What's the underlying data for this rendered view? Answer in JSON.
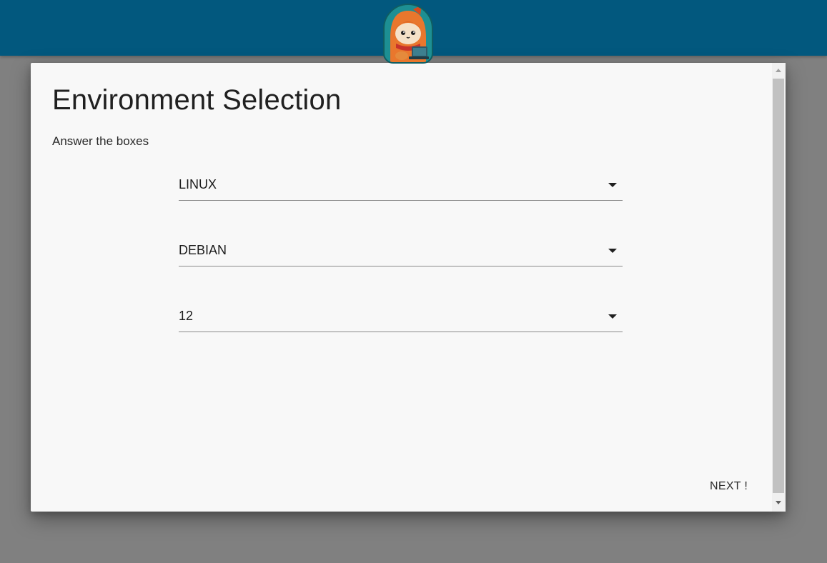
{
  "header": {
    "mascot_icon": "fox-mascot-with-laptop-icon",
    "bar_color": "#02587e"
  },
  "dialog": {
    "title": "Environment Selection",
    "subtitle": "Answer the boxes",
    "selects": [
      {
        "value": "LINUX"
      },
      {
        "value": "DEBIAN"
      },
      {
        "value": "12"
      }
    ],
    "next_label": "NEXT !"
  }
}
